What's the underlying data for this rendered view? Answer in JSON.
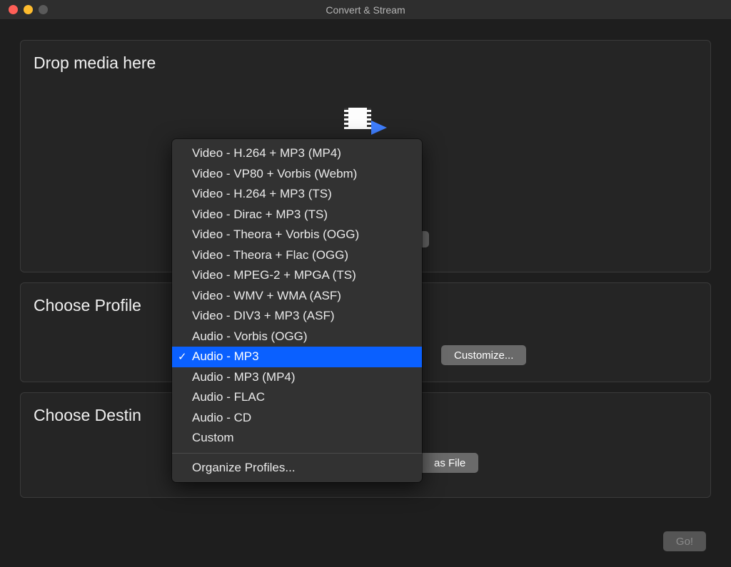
{
  "window": {
    "title": "Convert & Stream"
  },
  "drop_panel": {
    "title": "Drop media here"
  },
  "profile_panel": {
    "title": "Choose Profile",
    "customize_label": "Customize..."
  },
  "dest_panel": {
    "title": "Choose Destination",
    "title_truncated": "Choose Destin",
    "as_file_label": "as File"
  },
  "go_button": {
    "label": "Go!"
  },
  "profile_menu": {
    "options": [
      {
        "label": "Video - H.264 + MP3 (MP4)",
        "selected": false
      },
      {
        "label": "Video - VP80 + Vorbis (Webm)",
        "selected": false
      },
      {
        "label": "Video - H.264 + MP3 (TS)",
        "selected": false
      },
      {
        "label": "Video - Dirac + MP3 (TS)",
        "selected": false
      },
      {
        "label": "Video - Theora + Vorbis (OGG)",
        "selected": false
      },
      {
        "label": "Video - Theora + Flac (OGG)",
        "selected": false
      },
      {
        "label": "Video - MPEG-2 + MPGA (TS)",
        "selected": false
      },
      {
        "label": "Video - WMV + WMA (ASF)",
        "selected": false
      },
      {
        "label": "Video - DIV3 + MP3 (ASF)",
        "selected": false
      },
      {
        "label": "Audio - Vorbis (OGG)",
        "selected": false
      },
      {
        "label": "Audio - MP3",
        "selected": true
      },
      {
        "label": "Audio - MP3 (MP4)",
        "selected": false
      },
      {
        "label": "Audio - FLAC",
        "selected": false
      },
      {
        "label": "Audio - CD",
        "selected": false
      },
      {
        "label": "Custom",
        "selected": false
      }
    ],
    "organize_label": "Organize Profiles..."
  }
}
